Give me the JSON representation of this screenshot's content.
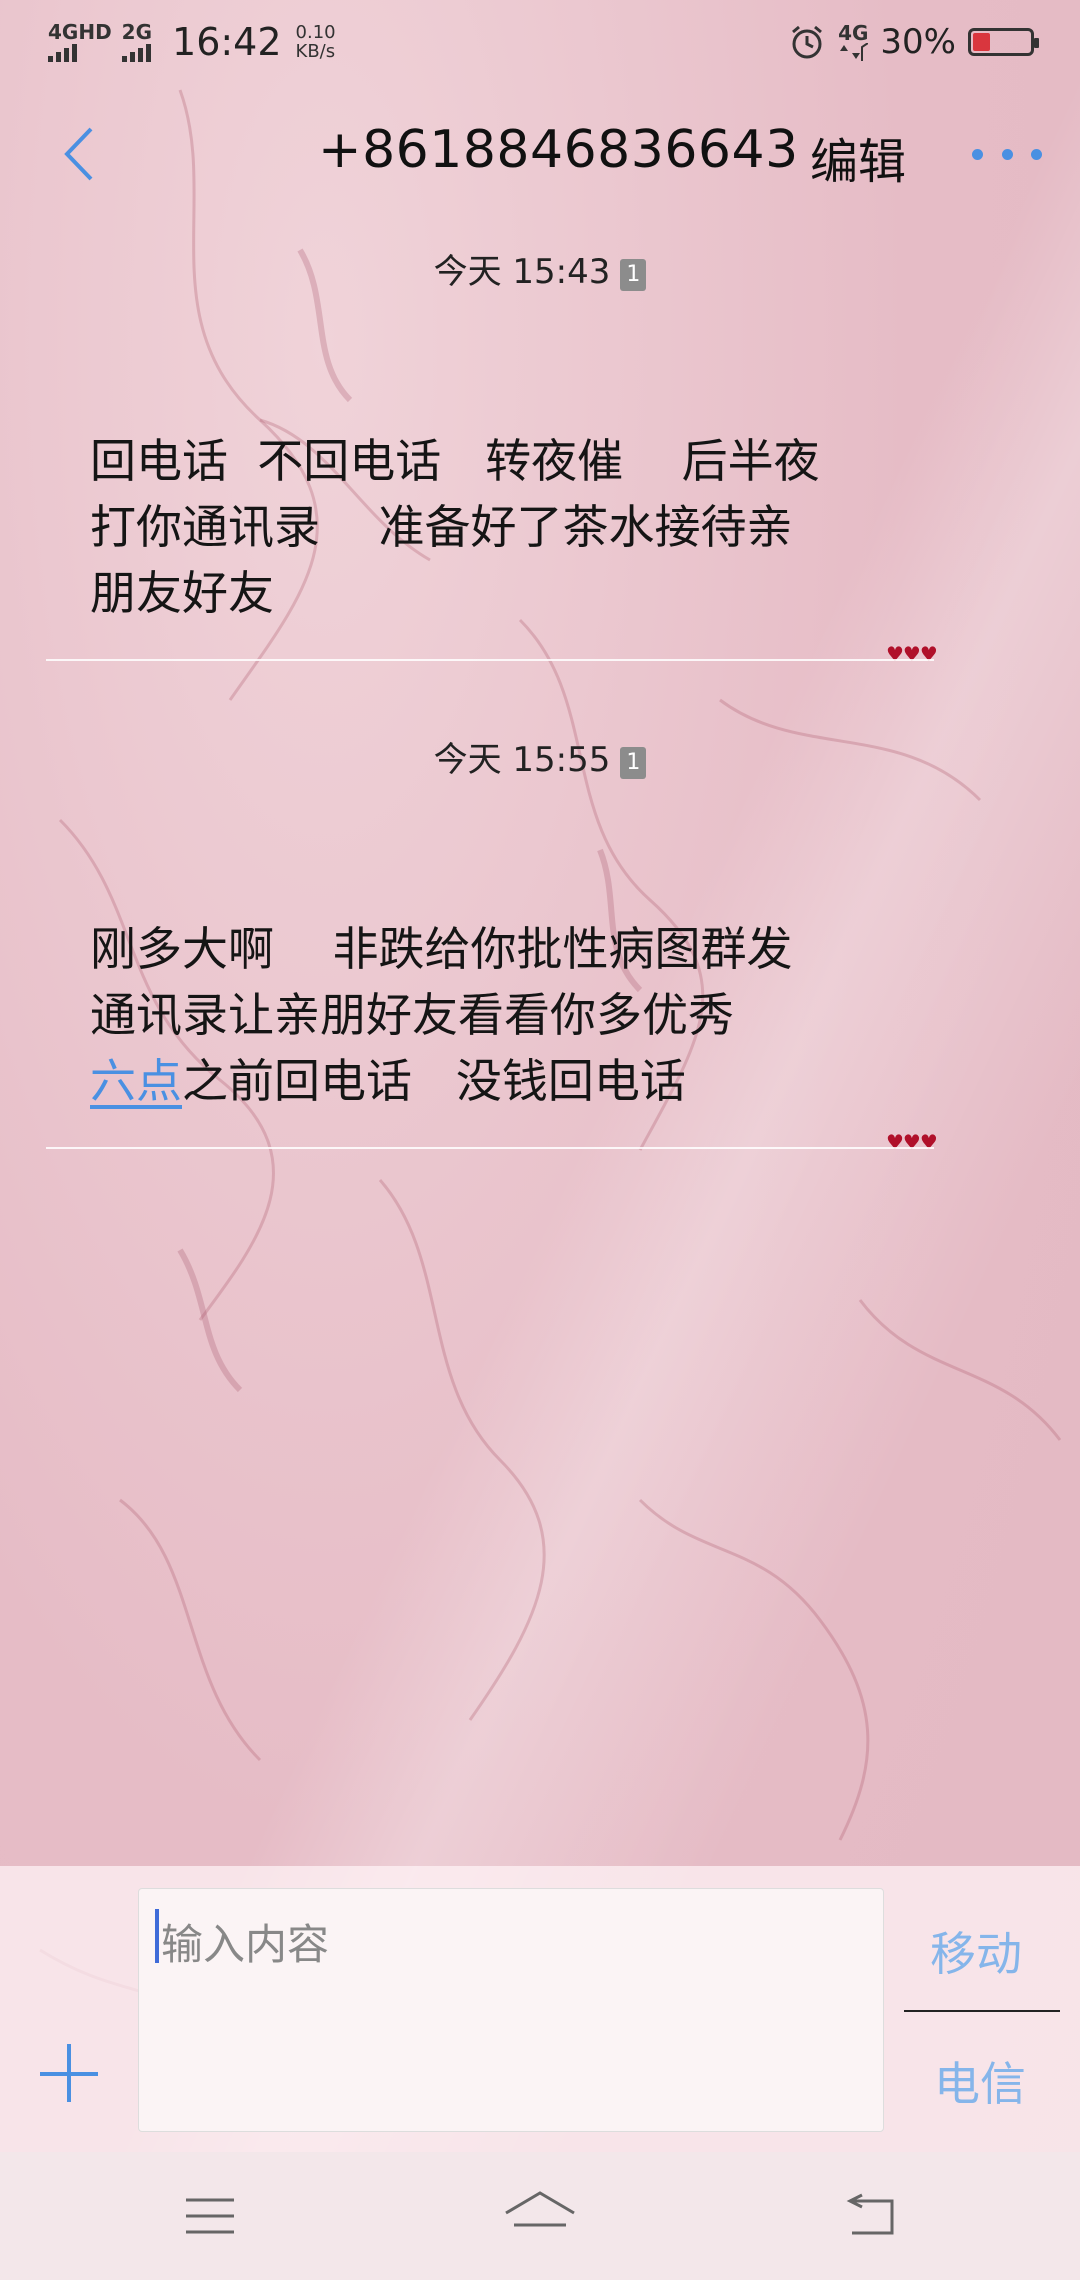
{
  "status_bar": {
    "signal1_label": "4GHD",
    "signal2_label": "2G",
    "time": "16:42",
    "net_speed_value": "0.10",
    "net_speed_unit": "KB/s",
    "volte_label": "4G",
    "battery_percent": "30%",
    "battery_level": 0.3,
    "icons": [
      "alarm-icon",
      "volte-icon",
      "battery-icon"
    ]
  },
  "header": {
    "back_icon": "chevron-left-icon",
    "title": "+8618846836643",
    "edit_label": "编辑",
    "more_icon": "more-icon"
  },
  "messages": [
    {
      "timestamp": "今天 15:43",
      "sim_badge": "1",
      "lines": [
        "回电话  不回电话   转夜催    后半夜",
        "打你通讯录    准备好了茶水接待亲",
        "朋友好友"
      ],
      "status_icon": "♥♥♥"
    },
    {
      "timestamp": "今天 15:55",
      "sim_badge": "1",
      "lines": [
        "刚多大啊    非跌给你批性病图群发",
        "通讯录让亲朋好友看看你多优秀"
      ],
      "link_text": "六点",
      "line3_rest": "之前回电话   没钱回电话",
      "status_icon": "♥♥♥"
    }
  ],
  "composer": {
    "add_icon": "plus-icon",
    "placeholder": "输入内容",
    "sim1_label": "移动",
    "sim2_label": "电信"
  },
  "nav": {
    "icons": [
      "menu-icon",
      "home-icon",
      "back-icon"
    ]
  },
  "colors": {
    "accent": "#4a90e2",
    "sim_label": "#85b5ea",
    "background": "#e9c5cd",
    "heart": "#b0102a"
  }
}
